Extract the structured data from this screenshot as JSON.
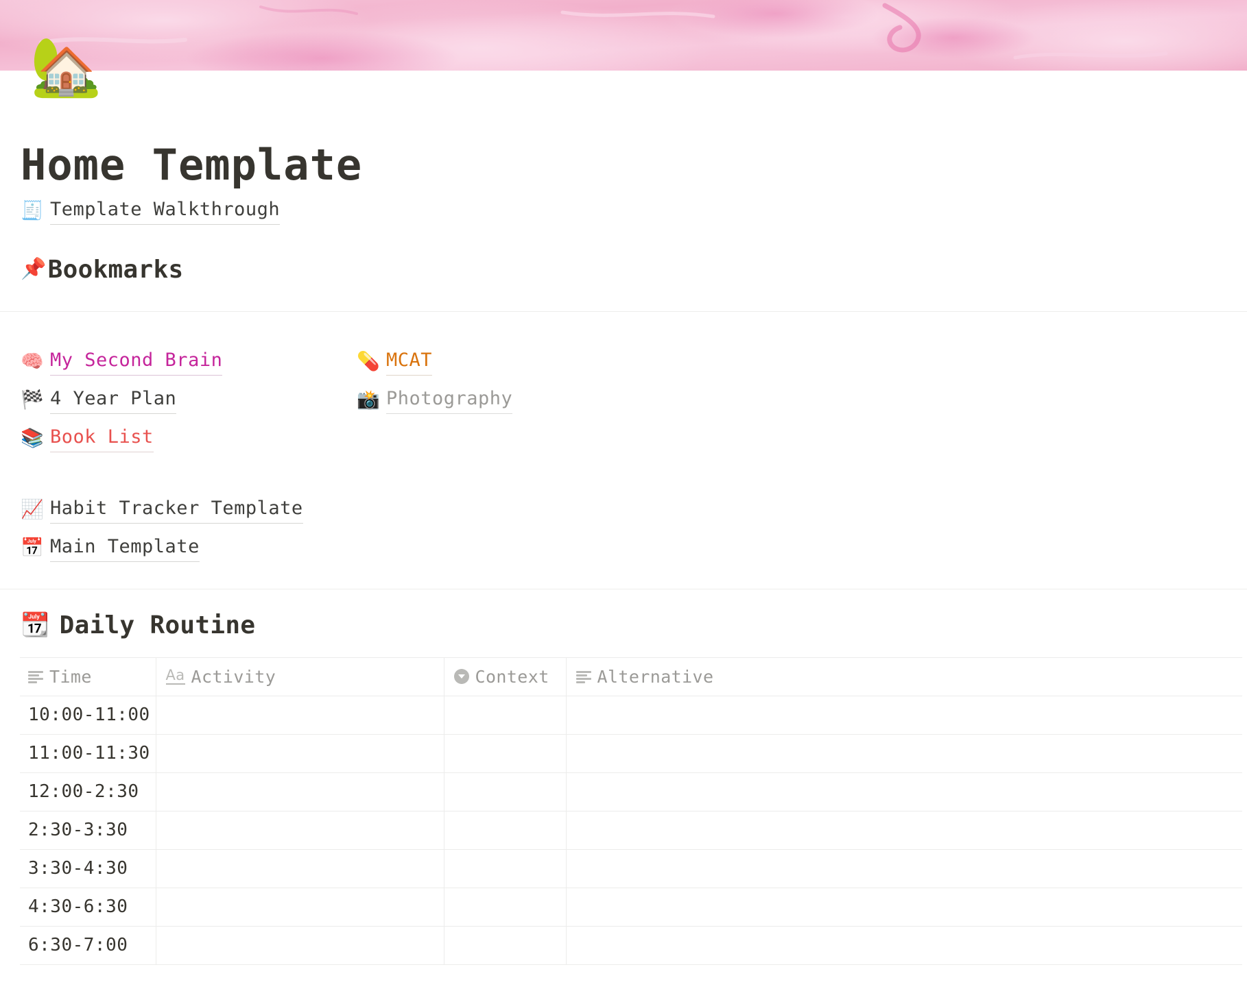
{
  "cover": {
    "name": "pink-marble-cover",
    "base_color": "#f3b3cd",
    "light_color": "#f8cfe0",
    "dark_color": "#ea82b4"
  },
  "page": {
    "icon": "🏡",
    "icon_name": "house-with-garden-emoji",
    "title": "Home Template"
  },
  "walkthrough": {
    "emoji": "🧾",
    "emoji_name": "receipt-emoji",
    "label": "Template Walkthrough"
  },
  "bookmarks_heading": {
    "emoji": "📌",
    "emoji_name": "pushpin-emoji",
    "label": "Bookmarks"
  },
  "bookmarks": {
    "left": [
      {
        "emoji": "🧠",
        "emoji_name": "brain-emoji",
        "label": "My Second Brain",
        "color_class": "pink",
        "color": "#c5259b"
      },
      {
        "emoji": "🏁",
        "emoji_name": "chequered-flag-emoji",
        "label": "4 Year Plan",
        "color_class": "",
        "color": "#3f3f3c"
      },
      {
        "emoji": "📚",
        "emoji_name": "books-emoji",
        "label": "Book List",
        "color_class": "red",
        "color": "#e8514e"
      }
    ],
    "right": [
      {
        "emoji": "💊",
        "emoji_name": "pill-emoji",
        "label": "MCAT",
        "color_class": "orange",
        "color": "#d9730d"
      },
      {
        "emoji": "📸",
        "emoji_name": "camera-with-flash-emoji",
        "label": "Photography",
        "color_class": "gray",
        "color": "#9b9a97"
      }
    ]
  },
  "templates": [
    {
      "emoji": "📈",
      "emoji_name": "chart-increasing-emoji",
      "label": "Habit Tracker Template"
    },
    {
      "emoji": "📅",
      "emoji_name": "calendar-emoji",
      "label": "Main Template"
    }
  ],
  "routine_heading": {
    "emoji": "📆",
    "emoji_name": "tear-off-calendar-emoji",
    "label": "Daily Routine"
  },
  "routine_table": {
    "columns": [
      {
        "label": "Time",
        "icon": "text-lines-icon"
      },
      {
        "label": "Activity",
        "icon": "title-aa-icon"
      },
      {
        "label": "Context",
        "icon": "select-circle-icon"
      },
      {
        "label": "Alternative",
        "icon": "text-lines-icon"
      }
    ],
    "rows": [
      {
        "time": "10:00-11:00",
        "activity": "",
        "context": "",
        "alternative": ""
      },
      {
        "time": "11:00-11:30",
        "activity": "",
        "context": "",
        "alternative": ""
      },
      {
        "time": "12:00-2:30",
        "activity": "",
        "context": "",
        "alternative": ""
      },
      {
        "time": "2:30-3:30",
        "activity": "",
        "context": "",
        "alternative": ""
      },
      {
        "time": "3:30-4:30",
        "activity": "",
        "context": "",
        "alternative": ""
      },
      {
        "time": "4:30-6:30",
        "activity": "",
        "context": "",
        "alternative": ""
      },
      {
        "time": "6:30-7:00",
        "activity": "",
        "context": "",
        "alternative": ""
      }
    ]
  }
}
